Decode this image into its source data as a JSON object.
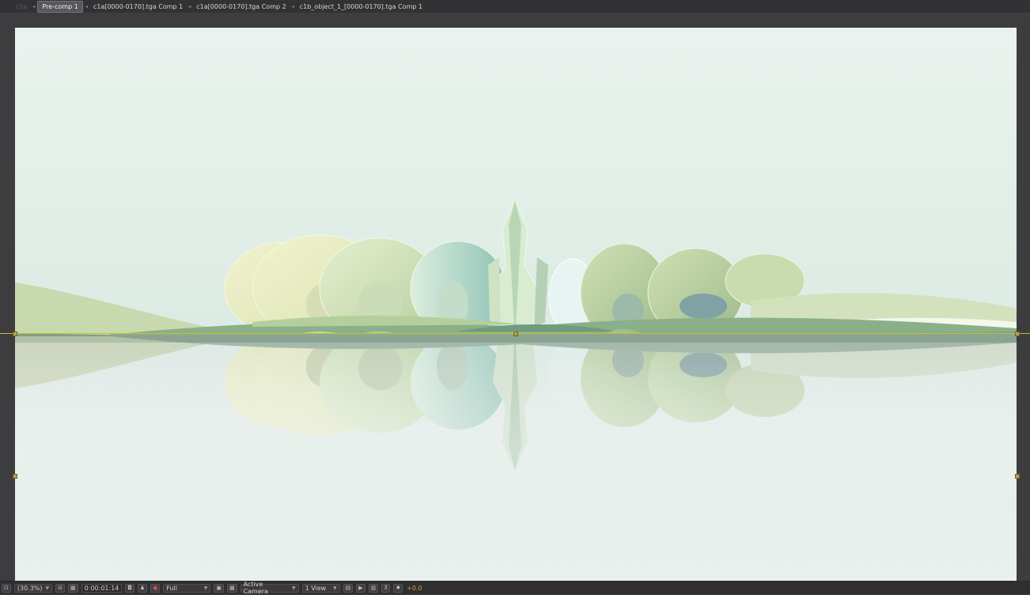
{
  "breadcrumbs": [
    {
      "label": "c1a",
      "state": "dim"
    },
    {
      "label": "Pre-comp 1",
      "state": "active"
    },
    {
      "label": "c1a[0000-0170].tga Comp 1",
      "state": "normal"
    },
    {
      "label": "c1a[0000-0170].tga Comp 2",
      "state": "normal"
    },
    {
      "label": "c1b_object_1_[0000-0170].tga Comp 1",
      "state": "normal"
    }
  ],
  "toolbar": {
    "magnification": "(30.3%)",
    "timecode": "0:00:01:14",
    "resolution": "Full",
    "camera": "Active Camera",
    "views": "1 View",
    "exposure": "+0.0"
  },
  "colors": {
    "panel_bg": "#3b3b3d",
    "guide_line": "#c9c21a",
    "exposure_text": "#d6a11a"
  },
  "icons": [
    "always-preview-icon",
    "region-of-interest-icon",
    "transparency-grid-icon",
    "snapshot-icon",
    "show-snapshot-icon",
    "channel-icon",
    "fast-preview-icon",
    "timeline-icon",
    "flowchart-icon",
    "reset-exposure-icon"
  ]
}
